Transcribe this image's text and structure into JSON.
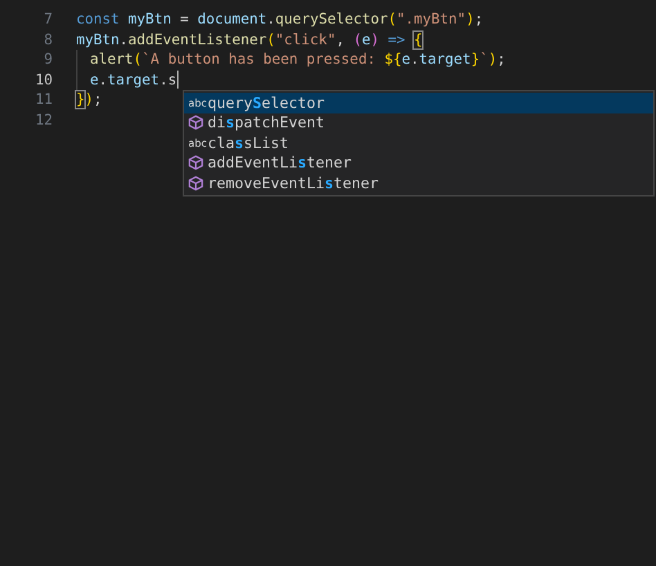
{
  "editor": {
    "lines": [
      {
        "number": "7",
        "indent": false,
        "current": false,
        "tokens": [
          {
            "kind": "keyword",
            "text": "const "
          },
          {
            "kind": "variable",
            "text": "myBtn"
          },
          {
            "kind": "plain",
            "text": " = "
          },
          {
            "kind": "variable",
            "text": "document"
          },
          {
            "kind": "plain",
            "text": "."
          },
          {
            "kind": "function",
            "text": "querySelector"
          },
          {
            "kind": "bracket",
            "text": "("
          },
          {
            "kind": "string",
            "text": "\".myBtn\""
          },
          {
            "kind": "bracket",
            "text": ")"
          },
          {
            "kind": "plain",
            "text": ";"
          }
        ]
      },
      {
        "number": "8",
        "indent": false,
        "current": false,
        "tokens": [
          {
            "kind": "variable",
            "text": "myBtn"
          },
          {
            "kind": "plain",
            "text": "."
          },
          {
            "kind": "function",
            "text": "addEventListener"
          },
          {
            "kind": "bracket",
            "text": "("
          },
          {
            "kind": "string",
            "text": "\"click\""
          },
          {
            "kind": "plain",
            "text": ", "
          },
          {
            "kind": "paren",
            "text": "("
          },
          {
            "kind": "variable",
            "text": "e"
          },
          {
            "kind": "paren",
            "text": ")"
          },
          {
            "kind": "keyword",
            "text": " => "
          },
          {
            "kind": "matched",
            "text": "{"
          }
        ]
      },
      {
        "number": "9",
        "indent": true,
        "current": false,
        "tokens": [
          {
            "kind": "function",
            "text": "alert"
          },
          {
            "kind": "bracket",
            "text": "("
          },
          {
            "kind": "string",
            "text": "`A button has been pressed: "
          },
          {
            "kind": "bracket",
            "text": "${"
          },
          {
            "kind": "variable",
            "text": "e"
          },
          {
            "kind": "plain",
            "text": "."
          },
          {
            "kind": "variable",
            "text": "target"
          },
          {
            "kind": "bracket",
            "text": "}"
          },
          {
            "kind": "string",
            "text": "`"
          },
          {
            "kind": "bracket",
            "text": ")"
          },
          {
            "kind": "plain",
            "text": ";"
          }
        ]
      },
      {
        "number": "10",
        "indent": true,
        "current": true,
        "cursor": true,
        "tokens": [
          {
            "kind": "variable",
            "text": "e"
          },
          {
            "kind": "plain",
            "text": "."
          },
          {
            "kind": "variable",
            "text": "target"
          },
          {
            "kind": "plain",
            "text": "."
          },
          {
            "kind": "plain",
            "text": "s"
          }
        ]
      },
      {
        "number": "11",
        "indent": false,
        "current": false,
        "tokens": [
          {
            "kind": "matched",
            "text": "}"
          },
          {
            "kind": "bracket",
            "text": ")"
          },
          {
            "kind": "plain",
            "text": ";"
          }
        ]
      },
      {
        "number": "12",
        "current": false
      }
    ]
  },
  "suggestions": [
    {
      "kind": "text",
      "selected": true,
      "icon": "abc",
      "before": "query",
      "match": "S",
      "after": "elector"
    },
    {
      "kind": "method",
      "selected": false,
      "before": "di",
      "match": "s",
      "after": "patchEvent"
    },
    {
      "kind": "text",
      "selected": false,
      "icon": "abc",
      "before": "cla",
      "match": "s",
      "after": "sList"
    },
    {
      "kind": "method",
      "selected": false,
      "before": "addEventLi",
      "match": "s",
      "after": "tener"
    },
    {
      "kind": "method",
      "selected": false,
      "before": "removeEventLi",
      "match": "s",
      "after": "tener"
    }
  ]
}
